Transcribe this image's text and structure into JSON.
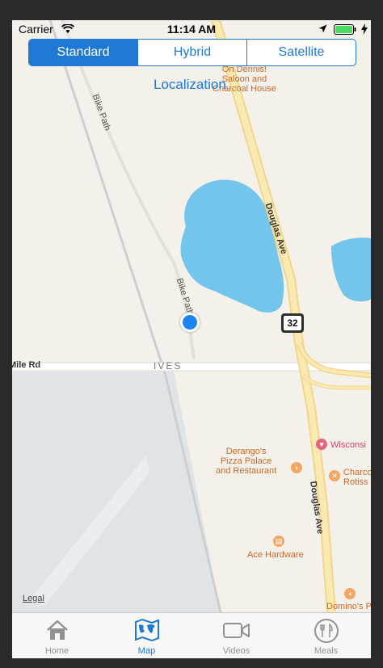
{
  "status_bar": {
    "carrier": "Carrier",
    "time": "11:14 AM"
  },
  "map_type_selector": {
    "segments": [
      "Standard",
      "Hybrid",
      "Satellite"
    ],
    "selected": "Standard"
  },
  "title_label": "Localization",
  "map": {
    "labels": {
      "bike_path_north": "Bike Path",
      "bike_path_south": "Bike Path",
      "douglas_ave_north": "Douglas Ave",
      "douglas_ave_south": "Douglas Ave",
      "mile_rd": "Mile Rd",
      "ives": "IVES"
    },
    "route_shield": "32",
    "pois": {
      "on_dennis": "On Dennis!\nSaloon and\nCharcoal House",
      "derangos": "Derango's\nPizza Palace\nand Restaurant",
      "wisconsin": "Wisconsi",
      "charco": "Charco\nRotiss",
      "ace_hardware": "Ace Hardware",
      "dominos": "Domino's Piz"
    },
    "legal": "Legal"
  },
  "tab_bar": {
    "tabs": [
      {
        "label": "Home",
        "icon": "house-icon"
      },
      {
        "label": "Map",
        "icon": "world-map-icon"
      },
      {
        "label": "Videos",
        "icon": "video-camera-icon"
      },
      {
        "label": "Meals",
        "icon": "fork-knife-icon"
      }
    ],
    "selected": "Map"
  },
  "colors": {
    "accent": "#1f78d1",
    "water": "#74c5ec",
    "road_major": "#f8e6a0",
    "park": "#e0e4e6"
  }
}
